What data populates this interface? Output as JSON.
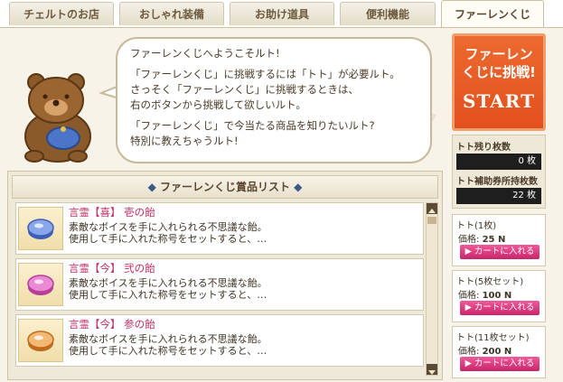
{
  "tabs": [
    {
      "label": "チェルトのお店"
    },
    {
      "label": "おしゃれ装備"
    },
    {
      "label": "お助け道具"
    },
    {
      "label": "便利機能"
    },
    {
      "label": "ファーレンくじ"
    }
  ],
  "bubble": {
    "line1": "ファーレンくじへようこそルト!",
    "line2": "「ファーレンくじ」に挑戦するには「トト」が必要ルト。",
    "line3": "さっそく「ファーレンくじ」に挑戦するときは、",
    "line4": "右のボタンから挑戦して欲しいルト。",
    "line5": "「ファーレンくじ」で今当たる商品を知りたいルト?",
    "line6": "特別に教えちゃうルト!"
  },
  "list": {
    "header": "ファーレンくじ賞品リスト",
    "items": [
      {
        "title": "言霊【喜】 壱の飴",
        "desc1": "素敵なボイスを手に入れられる不思議な飴。",
        "desc2": "使用して手に入れた称号をセットすると、…",
        "candy_color": "#6a86d8"
      },
      {
        "title": "言霊【今】 弐の飴",
        "desc1": "素敵なボイスを手に入れられる不思議な飴。",
        "desc2": "使用して手に入れた称号をセットすると、…",
        "candy_color": "#d86ac0"
      },
      {
        "title": "言霊【今】 参の飴",
        "desc1": "素敵なボイスを手に入れられる不思議な飴。",
        "desc2": "使用して手に入れた称号をセットすると、…",
        "candy_color": "#e08a3a"
      }
    ]
  },
  "start_button": {
    "line1": "ファーレン",
    "line2": "くじに挑戦!",
    "line3": "START"
  },
  "counts": {
    "remaining_label": "トト残り枚数",
    "remaining_value": "0 枚",
    "support_label": "トト補助券所持枚数",
    "support_value": "22 枚"
  },
  "purchases": [
    {
      "name": "トト(1枚)",
      "price_label": "価格:",
      "price": "25 N",
      "cart": "カートに入れる"
    },
    {
      "name": "トト(5枚セット)",
      "price_label": "価格:",
      "price": "100 N",
      "cart": "カートに入れる"
    },
    {
      "name": "トト(11枚セット)",
      "price_label": "価格:",
      "price": "200 N",
      "cart": "カートに入れる"
    }
  ],
  "colors": {
    "accent": "#e3501d",
    "cart": "#d63a7e",
    "title_pink": "#c03060"
  }
}
